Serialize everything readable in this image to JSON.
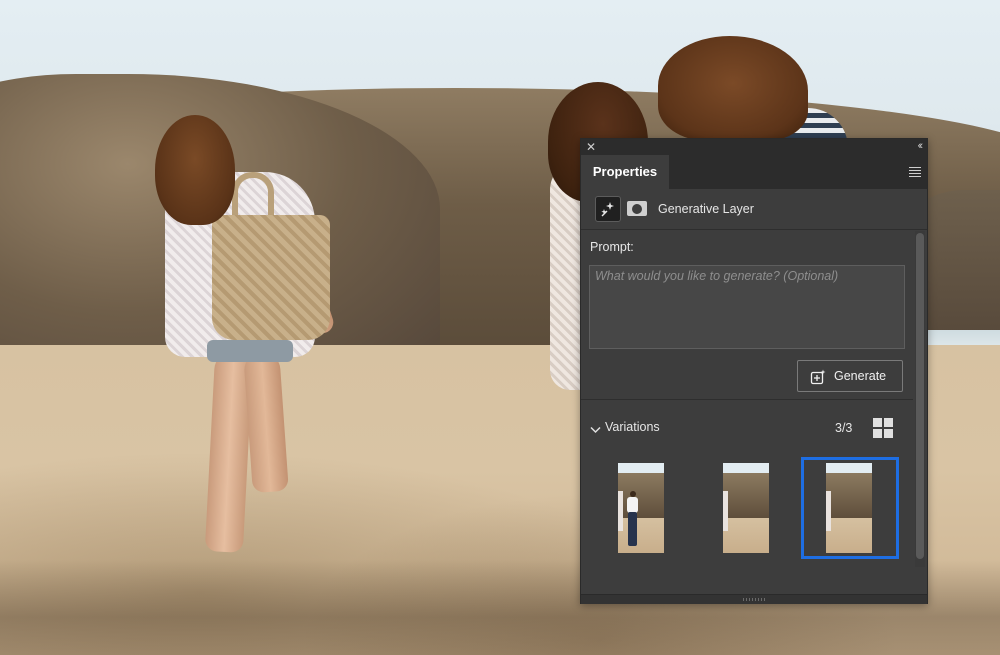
{
  "panel": {
    "close_glyph": "✕",
    "collapse_glyph": "‹‹",
    "tab_label": "Properties",
    "menu_icon": "hamburger-menu-icon"
  },
  "layer": {
    "name": "Generative Layer",
    "icon": "generative-sparkle-icon",
    "mask_icon": "layer-mask-icon"
  },
  "prompt": {
    "label": "Prompt:",
    "value": "",
    "placeholder": "What would you like to generate? (Optional)"
  },
  "generate_button": {
    "label": "Generate",
    "icon": "generate-plus-sparkle-icon"
  },
  "variations": {
    "label": "Variations",
    "count": "3/3",
    "expanded": true,
    "grid_icon": "grid-view-icon",
    "selected_index": 2,
    "items": [
      {
        "id": 1,
        "content": "person-walking"
      },
      {
        "id": 2,
        "content": "empty-beach"
      },
      {
        "id": 3,
        "content": "empty-beach"
      }
    ]
  },
  "colors": {
    "panel_bg": "#3d3d3d",
    "header_bg": "#2c2c2c",
    "selection_accent": "#1e6ee3",
    "text": "#e6e6e6",
    "placeholder": "#8e8e8e"
  }
}
